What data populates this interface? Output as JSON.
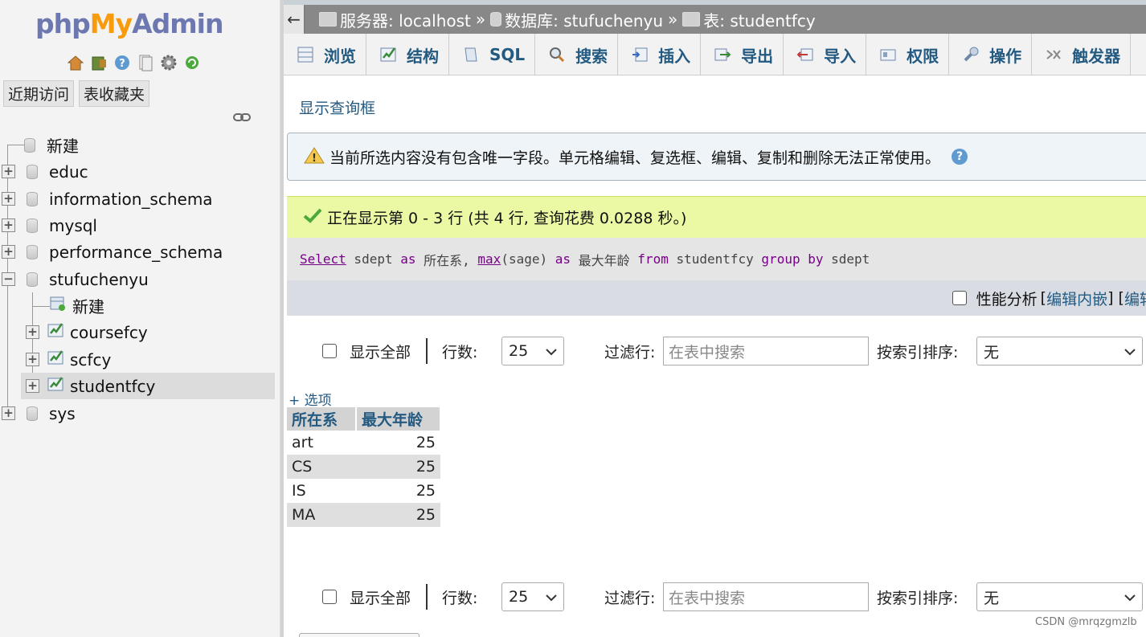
{
  "logo": {
    "php": "php",
    "my": "My",
    "admin": "Admin"
  },
  "nav": {
    "tabs": [
      "近期访问",
      "表收藏夹"
    ],
    "icons": [
      "home-icon",
      "logout-icon",
      "help-icon",
      "docs-icon",
      "settings-icon",
      "reload-icon"
    ],
    "tree": [
      {
        "label": "新建"
      },
      {
        "label": "educ"
      },
      {
        "label": "information_schema"
      },
      {
        "label": "mysql"
      },
      {
        "label": "performance_schema"
      },
      {
        "label": "stufuchenyu"
      },
      {
        "label": "新建"
      },
      {
        "label": "coursefcy"
      },
      {
        "label": "scfcy"
      },
      {
        "label": "studentfcy"
      },
      {
        "label": "sys"
      }
    ]
  },
  "breadcrumb": {
    "server": "服务器: localhost",
    "database": "数据库: stufuchenyu",
    "table": "表: studentfcy",
    "separator": "»"
  },
  "tabs": [
    "浏览",
    "结构",
    "SQL",
    "搜索",
    "插入",
    "导出",
    "导入",
    "权限",
    "操作",
    "触发器"
  ],
  "show_query": "显示查询框",
  "warning": "当前所选内容没有包含唯一字段。单元格编辑、复选框、编辑、复制和删除无法正常使用。",
  "success": "正在显示第 0 - 3 行 (共 4 行, 查询花费 0.0288 秒。)",
  "sql": {
    "t1": "Select",
    "t2": " sdept ",
    "t3": "as",
    "t4": " 所在系, ",
    "t5": "max",
    "t6": "(sage) ",
    "t7": "as",
    "t8": " 最大年龄 ",
    "t9": "from",
    "t10": " studentfcy ",
    "t11": "group by",
    "t12": " sdept"
  },
  "perf": {
    "label": "性能分析",
    "edit_inline": "编辑内嵌",
    "edit": "编辑"
  },
  "controls": {
    "show_all": "显示全部",
    "rows_label": "行数:",
    "rows_value": "25",
    "filter_label": "过滤行:",
    "filter_placeholder": "在表中搜索",
    "sort_label": "按索引排序:",
    "sort_value": "无"
  },
  "options_link": "+ 选项",
  "result": {
    "columns": [
      "所在系",
      "最大年龄"
    ],
    "rows": [
      [
        "art",
        "25"
      ],
      [
        "CS",
        "25"
      ],
      [
        "IS",
        "25"
      ],
      [
        "MA",
        "25"
      ]
    ]
  },
  "watermark": "CSDN @mrqzgmzlb"
}
